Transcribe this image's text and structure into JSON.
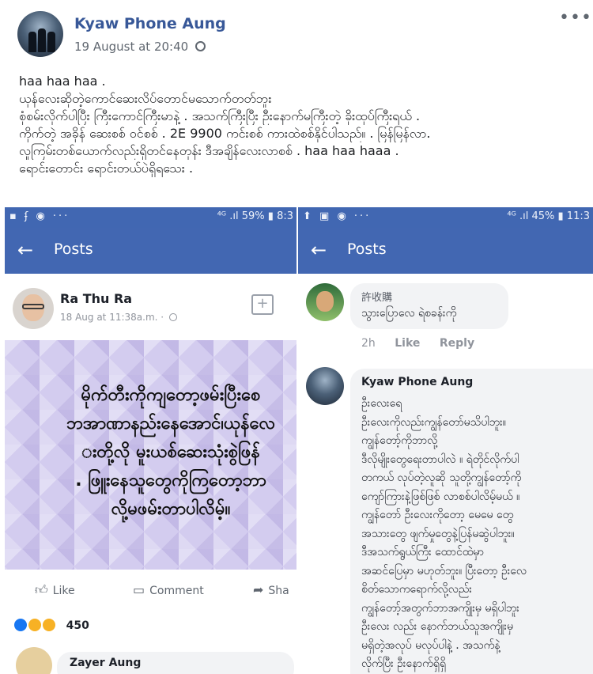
{
  "post": {
    "author": "Kyaw Phone Aung",
    "timestamp": "19 August at 20:40",
    "more_label": "•••",
    "text_lines": [
      "haa haa haa .",
      "ယုန်လေးဆိုတဲ့ကောင်ဆေးလိပ်တောင်မသောက်တတ်ဘူး",
      "စုံစမ်းလိုက်ပါပြီး ကြီးကောင်ကြီးမာနဲ့ . အသက်ကြီးပြီး ဦးနောက်မကြီးတဲ့ ခိုးထုပ်ကြီးရယ် . ",
      "ကိုက်တဲ့ အခိုန် ဆေးစစ် ဝင်စစ် . 2E 9900 ကင်းစစ် ကားထဲစစ်နိုင်ပါသည်။ . မြန်မြန်လာ.",
      "လူကြမ်းတစ်ယောက်လည်းရှိတင်နေတုန်း ဒီအချိန်လေးလာစစ် . haa haa haaa .",
      "ရောင်းတောင်း ရောင်းတယ်ပဲရှိရသေး ."
    ]
  },
  "left_shot": {
    "status_left": "▪ ʄ ◉ ···",
    "status_right": "⁴ᴳ .ıl 59% ▮ 8:3",
    "back_arrow": "←",
    "title": "Posts",
    "poster_name": "Ra Thu Ra",
    "poster_date": "18 Aug at 11:38a.m. ·",
    "save_icon": "+",
    "quote_lines": [
      "မိုက်တီးကိုကျတော့ဖမ်းပြီးစေ",
      "ဘအာဏာနည်းနေအောင်၊ယုန်လေ",
      "းတို့လို မူးယစ်ဆေးသုံးစွဲဖြန်",
      ". ဖြူးနေသူတွေကိုကြတော့ဘာ",
      "လို့မဖမ်းတာပါလိမ့်။"
    ],
    "like_label": "Like",
    "comment_label": "Comment",
    "share_label": "Sha",
    "reaction_count": "450",
    "commenter_name": "Zayer Aung",
    "reaction_colors": [
      "#1877f2",
      "#f7b125",
      "#f7b125"
    ]
  },
  "right_shot": {
    "status_left": "⬆ ▣ ◉ ···",
    "status_right": "⁴ᴳ .ıl 45% ▮ 11:3",
    "back_arrow": "←",
    "title": "Posts",
    "comment1_name": "許收購",
    "comment1_text": "သွားပြောလေ ရဲစခန်းကို",
    "comment1_time": "2h",
    "comment1_like": "Like",
    "comment1_reply": "Reply",
    "comment2_name": "Kyaw Phone Aung",
    "comment2_lines": [
      "ဦးလေးရေ",
      "ဦးလေးကိုလည်းကျွန်တော်မသိပါဘူး။",
      "ကျွန်တော့်ကိုဘာလို့",
      "ဒီလိုမျိုးတွေရေးတာပါလဲ ။ ရဲတိုင်လိုက်ပါ",
      "တကယ် လုပ်တဲ့လူဆို သူတို့ကျွန်တော့်ကို",
      "ကျော်ကြားနဲ့ဖြစ်ဖြစ် လာစစ်ပါလိမ့်မယ် ။",
      "ကျွန်တော် ဦးလေးကိုတော့ မေမေ တွေ",
      "အသားတွေ ဖျက်မှုတွေနဲ့ပြန်မဆွဲပါဘူး။",
      "ဒီအသက်ရွယ်ကြီး ထောင်ထဲမှာ",
      "အဆင်ပြေမှာ မဟုတ်ဘူး။ ပြီးတော့ ဦးလေ",
      "စိတ်သောကရောက်လို့လည်း",
      "ကျွန်တော့်အတွက်ဘာအကျိုးမှ မရှိပါဘူး",
      "ဦးလေး လည်း နောက်ဘယ်သူအကျိုးမှ",
      "မရှိတဲ့အလုပ် မလုပ်ပါနဲ့ . အသက်နဲ့",
      "လိုက်ပြီး ဦးနောက်ရှိရှိ"
    ]
  }
}
